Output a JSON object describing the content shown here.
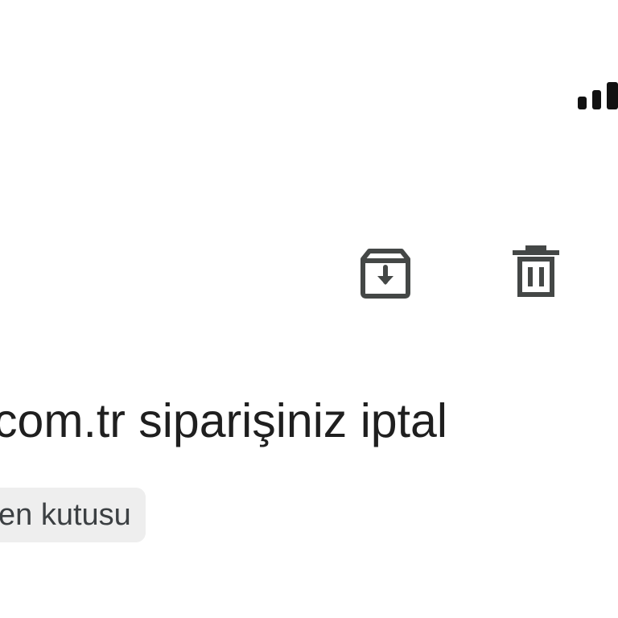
{
  "toolbar": {
    "archive_icon": "archive-icon",
    "delete_icon": "trash-icon"
  },
  "email": {
    "subject": "com.tr siparişiniz iptal",
    "label": "en kutusu"
  },
  "status_bar": {
    "signal_icon": "signal-strength-icon"
  },
  "colors": {
    "background": "#ffffff",
    "text": "#1f1f1f",
    "icon": "#444746",
    "chip_background": "#eeeeee",
    "chip_text": "#3c4043"
  }
}
